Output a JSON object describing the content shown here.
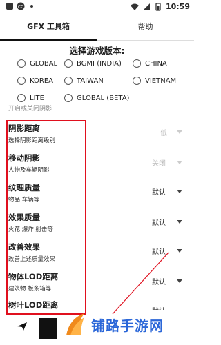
{
  "status": {
    "time": "10:59",
    "left_icons": [
      "app-icon",
      "cc-icon",
      "dot-icon"
    ]
  },
  "tabs": [
    {
      "label": "GFX 工具箱"
    },
    {
      "label": "帮助"
    }
  ],
  "version_section": {
    "title": "选择游戏版本:",
    "options": [
      "GLOBAL",
      "BGMI (INDIA)",
      "CHINA",
      "KOREA",
      "TAIWAN",
      "VIETNAM",
      "LITE",
      "GLOBAL (BETA)"
    ]
  },
  "ghost_text": "开启或关闭阴影",
  "settings": [
    {
      "title": "阴影距离",
      "desc": "选择阴影距离级别",
      "value": "低",
      "enabled": false
    },
    {
      "title": "移动阴影",
      "desc": "人物及车辆阴影",
      "value": "关闭",
      "enabled": false
    },
    {
      "title": "纹理质量",
      "desc": "物品 车辆等",
      "value": "默认",
      "enabled": true
    },
    {
      "title": "效果质量",
      "desc": "火花 爆炸 射击等",
      "value": "默认",
      "enabled": true
    },
    {
      "title": "改善效果",
      "desc": "改善上述质量效果",
      "value": "默认",
      "enabled": true
    },
    {
      "title": "物体LOD距离",
      "desc": "建筑物 板条箱等",
      "value": "默认",
      "enabled": true
    },
    {
      "title": "树叶LOD距离",
      "desc": "",
      "value": "默认",
      "enabled": true
    }
  ],
  "watermark": {
    "text": "铺路手游网"
  },
  "colors": {
    "annotation": "#e0101e",
    "watermark": "#2b67d8"
  }
}
